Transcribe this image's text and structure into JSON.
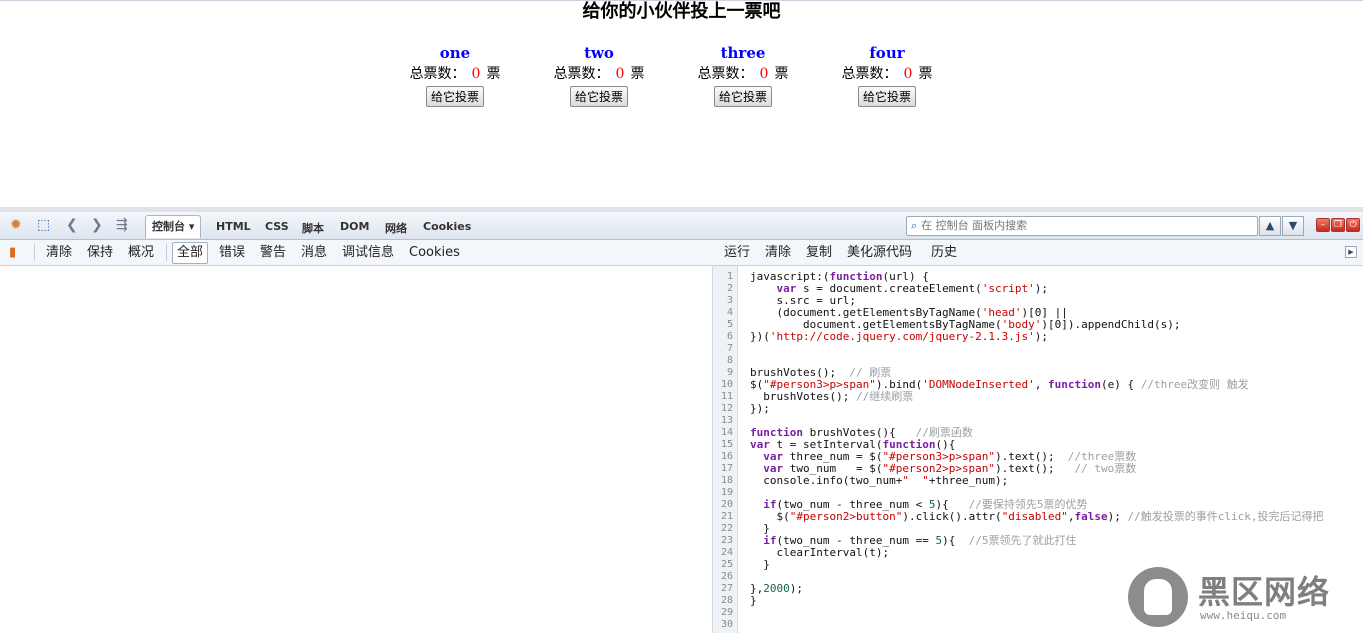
{
  "page": {
    "title": "给你的小伙伴投上一票吧",
    "persons": [
      {
        "name": "one",
        "count_label": "总票数：",
        "count": "0",
        "unit": "票",
        "button": "给它投票"
      },
      {
        "name": "two",
        "count_label": "总票数：",
        "count": "0",
        "unit": "票",
        "button": "给它投票"
      },
      {
        "name": "three",
        "count_label": "总票数：",
        "count": "0",
        "unit": "票",
        "button": "给它投票"
      },
      {
        "name": "four",
        "count_label": "总票数：",
        "count": "0",
        "unit": "票",
        "button": "给它投票"
      }
    ]
  },
  "devtools": {
    "tabs": [
      "控制台",
      "HTML",
      "CSS",
      "脚本",
      "DOM",
      "网络",
      "Cookies"
    ],
    "active_tab_arrow": "▾",
    "search_placeholder": "在 控制台 面板内搜索",
    "console_toolbar": {
      "left": [
        "清除",
        "保持",
        "概况"
      ],
      "filters": [
        "全部",
        "错误",
        "警告",
        "消息",
        "调试信息",
        "Cookies"
      ],
      "right": [
        "运行",
        "清除",
        "复制",
        "美化源代码",
        "历史"
      ]
    },
    "line_numbers": [
      "1",
      "2",
      "3",
      "4",
      "5",
      "6",
      "7",
      "8",
      "9",
      "10",
      "11",
      "12",
      "13",
      "14",
      "15",
      "16",
      "17",
      "18",
      "19",
      "20",
      "21",
      "22",
      "23",
      "24",
      "25",
      "26",
      "27",
      "28",
      "29",
      "30"
    ]
  },
  "watermark": {
    "title": "黑区网络",
    "url": "www.heiqu.com"
  },
  "colors": {
    "name": "#0000ff",
    "count": "#ff0000",
    "keyword": "#7b1fa2",
    "string": "#c80000",
    "comment": "#9aa0a6"
  }
}
